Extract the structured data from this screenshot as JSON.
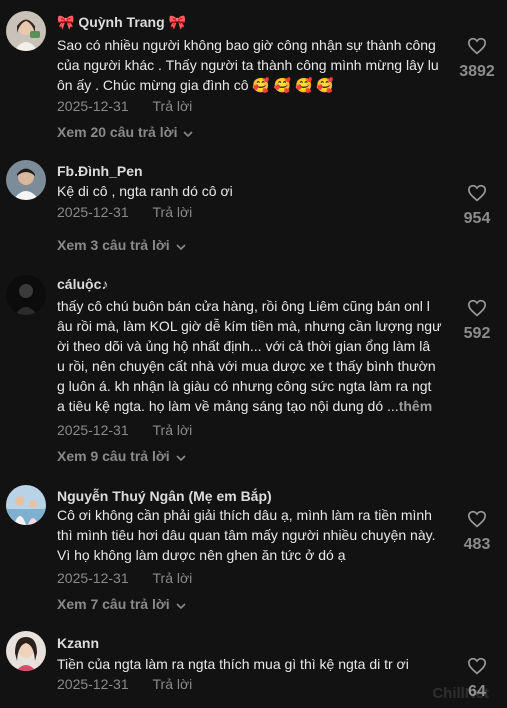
{
  "comments": [
    {
      "username": "🎀 Quỳnh Trang 🎀",
      "lines": [
        "Sao có nhiều người không bao giờ công nhận sự thành công",
        "của người khác . Thấy người ta thành công mình mừng lây lu",
        "ôn ấy . Chúc mừng gia đình cô 🥰 🥰 🥰 🥰"
      ],
      "date": "2025-12-31",
      "reply_label": "Trả lời",
      "view_replies": "Xem 20 câu trả lời",
      "likes": "3892"
    },
    {
      "username": "Fb.Đình_Pen",
      "lines": [
        "Kệ di cô , ngta ranh dó cô ơi"
      ],
      "date": "2025-12-31",
      "reply_label": "Trả lời",
      "view_replies": "Xem 3 câu trả lời",
      "likes": "954"
    },
    {
      "username": "cáluộc♪",
      "lines": [
        "thấy cô chú buôn bán cửa hàng, rồi ông Liêm cũng bán onl l",
        "âu rồi mà, làm KOL giờ dễ kím tiền mà, nhưng cần lượng ngư",
        "ời theo dõi và ủng hộ nhất định... với cả thời gian ổng làm lâ",
        "u rồi, nên chuyện cất nhà với mua dược xe t thấy bình thườn",
        "g luôn á. kh nhận là giàu có nhưng công sức ngta làm ra ngt",
        "a tiêu kệ ngta. họ làm về mảng sáng tạo nội dung dó ..."
      ],
      "more_label": "thêm",
      "date": "2025-12-31",
      "reply_label": "Trả lời",
      "view_replies": "Xem 9 câu trả lời",
      "likes": "592"
    },
    {
      "username": "Nguyễn Thuý Ngân (Mẹ em Bắp)",
      "lines": [
        "Cô ơi không cần phải giải thích dâu ạ, mình làm ra tiền mình",
        "thì mình tiêu hơi dâu quan tâm mấy người nhiều chuyện này.",
        "Vì họ không làm dược nên ghen ăn tức ở dó ạ"
      ],
      "date": "2025-12-31",
      "reply_label": "Trả lời",
      "view_replies": "Xem 7 câu trả lời",
      "likes": "483"
    },
    {
      "username": "Kzann",
      "lines": [
        "Tiền của ngta làm ra ngta thích mua gì thì kệ ngta di tr ơi"
      ],
      "date": "2025-12-31",
      "reply_label": "Trả lời",
      "likes": "64"
    }
  ],
  "watermark": "ChillNet",
  "icons": {
    "like": "heart-outline-icon",
    "expand": "chevron-down-icon"
  },
  "colors": {
    "background": "#121212",
    "text": "#e8e8e8",
    "muted": "#8a8a8a"
  }
}
